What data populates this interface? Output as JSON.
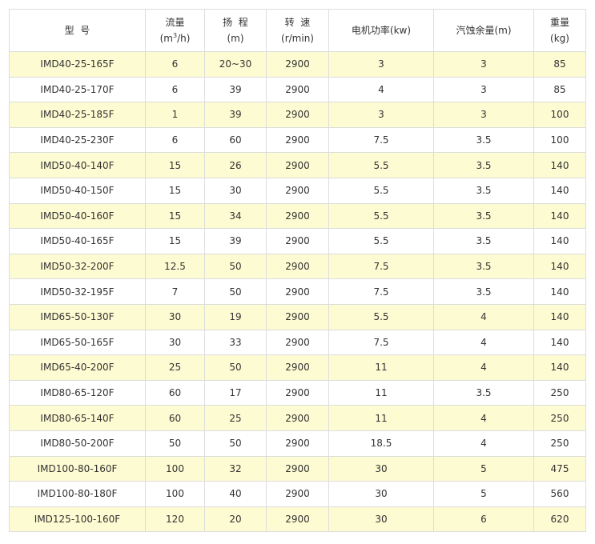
{
  "headers": {
    "model": "型  号",
    "flow": "流量",
    "flow_unit_pre": "(m",
    "flow_unit_sup": "3",
    "flow_unit_post": "/h)",
    "head": "扬  程",
    "head_unit": "(m)",
    "speed": "转  速",
    "speed_unit": "(r/min)",
    "power": "电机功率(kw)",
    "npsh": "汽蚀余量(m)",
    "weight": "重量",
    "weight_unit": "(kg)"
  },
  "rows": [
    [
      "IMD40-25-165F",
      "6",
      "20~30",
      "2900",
      "3",
      "3",
      "85"
    ],
    [
      "IMD40-25-170F",
      "6",
      "39",
      "2900",
      "4",
      "3",
      "85"
    ],
    [
      "IMD40-25-185F",
      "1",
      "39",
      "2900",
      "3",
      "3",
      "100"
    ],
    [
      "IMD40-25-230F",
      "6",
      "60",
      "2900",
      "7.5",
      "3.5",
      "100"
    ],
    [
      "IMD50-40-140F",
      "15",
      "26",
      "2900",
      "5.5",
      "3.5",
      "140"
    ],
    [
      "IMD50-40-150F",
      "15",
      "30",
      "2900",
      "5.5",
      "3.5",
      "140"
    ],
    [
      "IMD50-40-160F",
      "15",
      "34",
      "2900",
      "5.5",
      "3.5",
      "140"
    ],
    [
      "IMD50-40-165F",
      "15",
      "39",
      "2900",
      "5.5",
      "3.5",
      "140"
    ],
    [
      "IMD50-32-200F",
      "12.5",
      "50",
      "2900",
      "7.5",
      "3.5",
      "140"
    ],
    [
      "IMD50-32-195F",
      "7",
      "50",
      "2900",
      "7.5",
      "3.5",
      "140"
    ],
    [
      "IMD65-50-130F",
      "30",
      "19",
      "2900",
      "5.5",
      "4",
      "140"
    ],
    [
      "IMD65-50-165F",
      "30",
      "33",
      "2900",
      "7.5",
      "4",
      "140"
    ],
    [
      "IMD65-40-200F",
      "25",
      "50",
      "2900",
      "11",
      "4",
      "140"
    ],
    [
      "IMD80-65-120F",
      "60",
      "17",
      "2900",
      "11",
      "3.5",
      "250"
    ],
    [
      "IMD80-65-140F",
      "60",
      "25",
      "2900",
      "11",
      "4",
      "250"
    ],
    [
      "IMD80-50-200F",
      "50",
      "50",
      "2900",
      "18.5",
      "4",
      "250"
    ],
    [
      "IMD100-80-160F",
      "100",
      "32",
      "2900",
      "30",
      "5",
      "475"
    ],
    [
      "IMD100-80-180F",
      "100",
      "40",
      "2900",
      "30",
      "5",
      "560"
    ],
    [
      "IMD125-100-160F",
      "120",
      "20",
      "2900",
      "30",
      "6",
      "620"
    ]
  ],
  "colors": {
    "odd_row": "#fdfbd1",
    "even_row": "#ffffff",
    "border": "#dddddd",
    "text": "#333333"
  }
}
